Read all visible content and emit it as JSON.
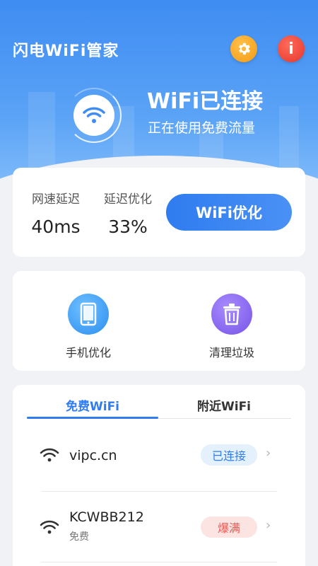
{
  "header": {
    "app_title": "闪电WiFi管家",
    "settings_icon": "gear-icon",
    "info_icon": "info-icon",
    "info_glyph": "i"
  },
  "status": {
    "title": "WiFi已连接",
    "subtitle": "正在使用免费流量"
  },
  "speed_card": {
    "latency_label": "网速延迟",
    "latency_value": "40ms",
    "optimize_label": "延迟优化",
    "optimize_value": "33%",
    "button_label": "WiFi优化"
  },
  "tools": [
    {
      "label": "手机优化",
      "icon": "phone-icon"
    },
    {
      "label": "清理垃圾",
      "icon": "trash-icon"
    }
  ],
  "wifi_tabs": [
    {
      "label": "免费WiFi",
      "active": true
    },
    {
      "label": "附近WiFi",
      "active": false
    }
  ],
  "wifi_list": [
    {
      "name": "vipc.cn",
      "sub": "",
      "badge": "已连接",
      "badge_type": "connected"
    },
    {
      "name": "KCWBB212",
      "sub": "免费",
      "badge": "爆满",
      "badge_type": "full"
    }
  ],
  "colors": {
    "accent": "#2f7cf0",
    "settings": "#f59a13",
    "info": "#e5372c",
    "full_badge": "#ea5a52"
  }
}
